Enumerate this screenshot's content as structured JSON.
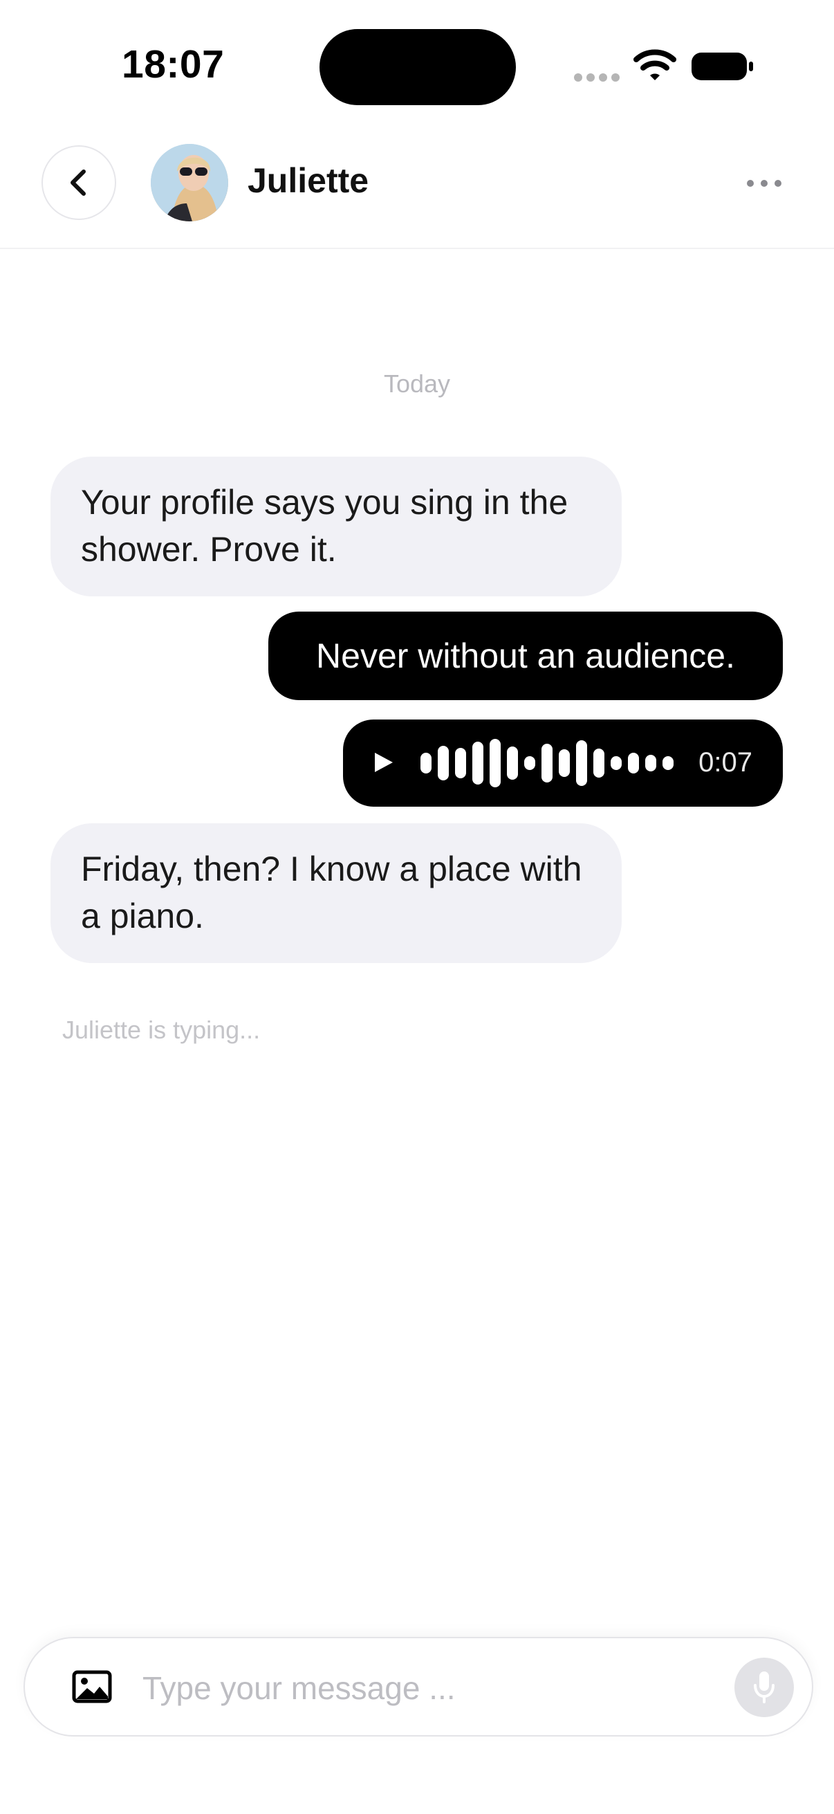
{
  "status_bar": {
    "time": "18:07",
    "icons": [
      "signal-dots-icon",
      "wifi-icon",
      "battery-icon"
    ]
  },
  "header": {
    "back_icon": "chevron-left-icon",
    "contact_name": "Juliette",
    "more_icon": "ellipsis-icon"
  },
  "conversation": {
    "day_label": "Today",
    "messages": [
      {
        "direction": "incoming",
        "type": "text",
        "text": "Your profile says you sing in the shower. Prove it."
      },
      {
        "direction": "outgoing",
        "type": "text",
        "text": "Never without an audience."
      },
      {
        "direction": "outgoing",
        "type": "voice",
        "duration": "0:07"
      },
      {
        "direction": "incoming",
        "type": "text",
        "text": "Friday, then? I know a place with a piano."
      }
    ],
    "typing_indicator": "Juliette is typing..."
  },
  "composer": {
    "placeholder": "Type your message ...",
    "value": "",
    "attach_icon": "image-icon",
    "mic_icon": "microphone-icon"
  },
  "colors": {
    "incoming_bubble": "#f1f1f6",
    "outgoing_bubble": "#000000",
    "muted_text": "#b9b9be"
  }
}
